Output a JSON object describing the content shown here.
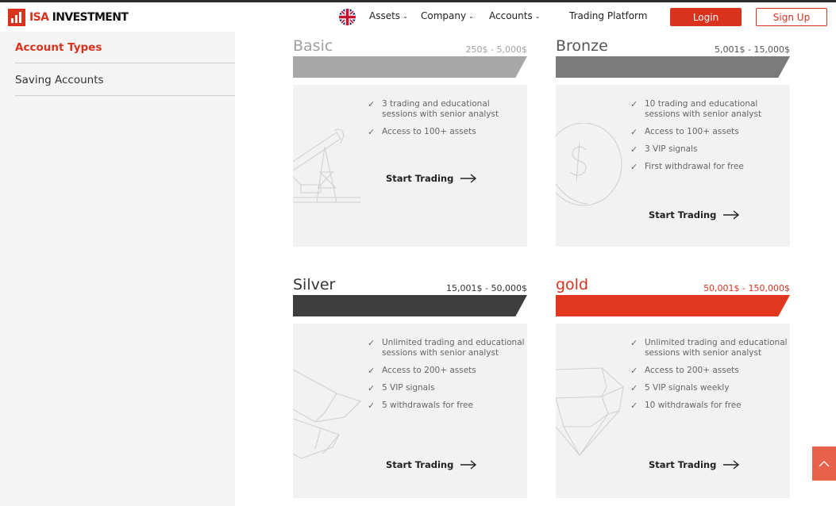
{
  "header": {
    "logo": {
      "isa": "ISA",
      "investment": "INVESTMENT"
    },
    "nav": [
      {
        "label": "Assets",
        "dropdown": true
      },
      {
        "label": "Company",
        "dropdown": true
      },
      {
        "label": "Accounts",
        "dropdown": true
      },
      {
        "label": "Trading Platform",
        "dropdown": false
      }
    ],
    "login_label": "Login",
    "signup_label": "Sign Up",
    "flag_icon": "uk-flag-icon"
  },
  "sidebar": {
    "items": [
      {
        "label": "Account Types",
        "active": true
      },
      {
        "label": "Saving Accounts",
        "active": false
      }
    ]
  },
  "accounts": [
    {
      "name": "Basic",
      "range": "250$ - 5,000$",
      "features": [
        "3 trading and educational sessions with senior analyst",
        "Access to 100+ assets"
      ],
      "cta": "Start Trading",
      "illustration": "oil-pump-icon"
    },
    {
      "name": "Bronze",
      "range": "5,001$ - 15,000$",
      "features": [
        "10 trading and educational sessions with senior analyst",
        "Access to 100+ assets",
        "3 VIP signals",
        "First withdrawal for free"
      ],
      "cta": "Start Trading",
      "illustration": "dollar-coin-icon"
    },
    {
      "name": "Silver",
      "range": "15,001$ - 50,000$",
      "features": [
        "Unlimited trading and educational sessions with senior analyst",
        "Access to 200+ assets",
        "5 VIP signals",
        "5 withdrawals for free"
      ],
      "cta": "Start Trading",
      "illustration": "silver-bars-icon"
    },
    {
      "name": "gold",
      "range": "50,001$ - 150,000$",
      "features": [
        "Unlimited trading and educational sessions with senior analyst",
        "Access to 200+ assets",
        "5 VIP signals weekly",
        "10 withdrawals for free"
      ],
      "cta": "Start Trading",
      "illustration": "diamond-icon"
    }
  ],
  "colors": {
    "accent": "#d9331e",
    "basic_bar": "#a7a7a7",
    "bronze_bar": "#7a7a7a",
    "silver_bar": "#3e3e3e",
    "gold_bar": "#e0371e"
  }
}
